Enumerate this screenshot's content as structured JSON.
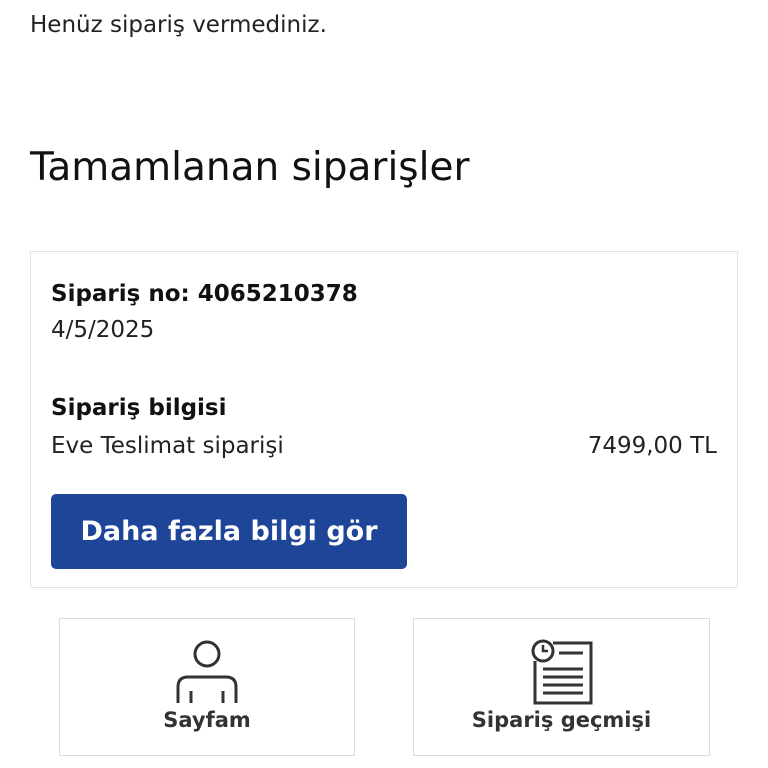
{
  "messages": {
    "no_orders": "Henüz sipariş vermediniz."
  },
  "completed": {
    "title": "Tamamlanan siparişler",
    "order": {
      "number_label": "Sipariş no: 4065210378",
      "date": "4/5/2025",
      "info_title": "Sipariş bilgisi",
      "type": "Eve Teslimat siparişi",
      "total": "7499,00 TL",
      "more_button_label": "Daha fazla bilgi gör"
    }
  },
  "tiles": {
    "my_page": {
      "label": "Sayfam",
      "icon": "user-icon"
    },
    "history": {
      "label": "Sipariş geçmişi",
      "icon": "order-history-icon"
    }
  },
  "colors": {
    "primary_button": "#1f4598"
  }
}
